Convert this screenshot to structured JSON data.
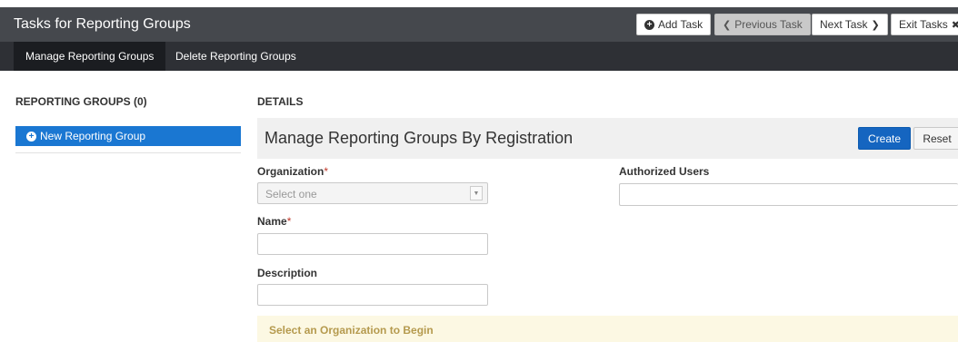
{
  "header": {
    "title": "Tasks for Reporting Groups",
    "add_task": "Add Task",
    "previous_task": "Previous Task",
    "next_task": "Next Task",
    "exit_tasks": "Exit Tasks"
  },
  "subnav": {
    "tabs": [
      {
        "label": "Manage Reporting Groups",
        "active": true
      },
      {
        "label": "Delete Reporting Groups",
        "active": false
      }
    ]
  },
  "left": {
    "heading": "REPORTING GROUPS (0)",
    "new_group": "New Reporting Group"
  },
  "details": {
    "heading": "DETAILS",
    "title": "Manage Reporting Groups By Registration",
    "create": "Create",
    "reset": "Reset",
    "organization_label": "Organization",
    "organization_placeholder": "Select one",
    "name_label": "Name",
    "description_label": "Description",
    "authorized_users_label": "Authorized Users",
    "required_mark": "*",
    "notice": "Select an Organization to Begin"
  },
  "colors": {
    "topbar": "#45484d",
    "subnav": "#2e3035",
    "accent": "#1a77d2",
    "notice_bg": "#fcf8e3"
  }
}
